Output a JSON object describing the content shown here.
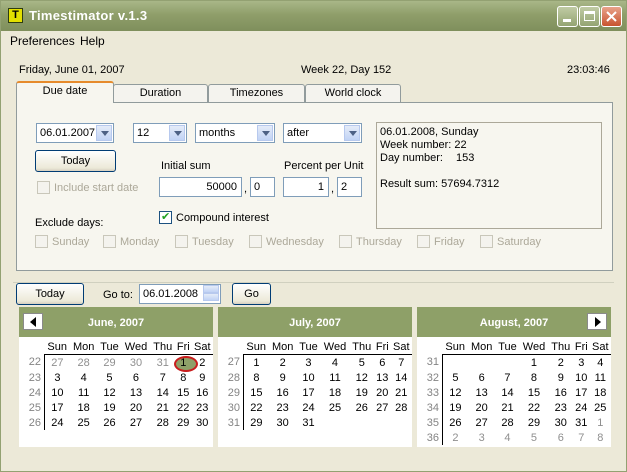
{
  "window": {
    "title": "Timestimator v.1.3",
    "icon_letter": "T"
  },
  "menu": {
    "items": [
      {
        "label": "Preferences",
        "accel": "P"
      },
      {
        "label": "Help",
        "accel": "H"
      }
    ]
  },
  "status": {
    "date": "Friday, June 01, 2007",
    "week": "Week 22, Day 152",
    "time": "23:03:46"
  },
  "tabs": [
    {
      "label": "Due date"
    },
    {
      "label": "Duration"
    },
    {
      "label": "Timezones"
    },
    {
      "label": "World clock"
    }
  ],
  "due": {
    "start_date": "06.01.2007",
    "amount": "12",
    "unit": "months",
    "direction": "after",
    "today_label": "Today",
    "include_start_label": "Include start date",
    "initial_sum_label": "Initial sum",
    "initial_sum_int": "50000",
    "initial_sum_frac": "0",
    "percent_label": "Percent per Unit",
    "percent_int": "1",
    "percent_frac": "2",
    "sep": ",",
    "compound_label": "Compound interest",
    "exclude_label": "Exclude days:",
    "weekdays": [
      "Sunday",
      "Monday",
      "Tuesday",
      "Wednesday",
      "Thursday",
      "Friday",
      "Saturday"
    ],
    "result": {
      "line1": "06.01.2008, Sunday",
      "line2": "Week number: 22",
      "line3_label": "Day number:",
      "line3_value": "153",
      "line4": "Result sum: 57694.7312"
    }
  },
  "goto": {
    "today_label": "Today",
    "goto_label": "Go to:",
    "date": "06.01.2008",
    "go_label": "Go"
  },
  "calendar": {
    "day_headers": [
      "Sun",
      "Mon",
      "Tue",
      "Wed",
      "Thu",
      "Fri",
      "Sat"
    ],
    "months": [
      {
        "title": "June, 2007",
        "weeks": [
          "22",
          "23",
          "24",
          "25",
          "26"
        ],
        "rows": [
          [
            [
              "27",
              true
            ],
            [
              "28",
              true
            ],
            [
              "29",
              true
            ],
            [
              "30",
              true
            ],
            [
              "31",
              true
            ],
            [
              "1",
              false
            ],
            [
              "2",
              false
            ]
          ],
          [
            [
              "3",
              false
            ],
            [
              "4",
              false
            ],
            [
              "5",
              false
            ],
            [
              "6",
              false
            ],
            [
              "7",
              false
            ],
            [
              "8",
              false
            ],
            [
              "9",
              false
            ]
          ],
          [
            [
              "10",
              false
            ],
            [
              "11",
              false
            ],
            [
              "12",
              false
            ],
            [
              "13",
              false
            ],
            [
              "14",
              false
            ],
            [
              "15",
              false
            ],
            [
              "16",
              false
            ]
          ],
          [
            [
              "17",
              false
            ],
            [
              "18",
              false
            ],
            [
              "19",
              false
            ],
            [
              "20",
              false
            ],
            [
              "21",
              false
            ],
            [
              "22",
              false
            ],
            [
              "23",
              false
            ]
          ],
          [
            [
              "24",
              false
            ],
            [
              "25",
              false
            ],
            [
              "26",
              false
            ],
            [
              "27",
              false
            ],
            [
              "28",
              false
            ],
            [
              "29",
              false
            ],
            [
              "30",
              false
            ]
          ]
        ],
        "today": "1"
      },
      {
        "title": "July, 2007",
        "weeks": [
          "27",
          "28",
          "29",
          "30",
          "31"
        ],
        "rows": [
          [
            [
              "1",
              false
            ],
            [
              "2",
              false
            ],
            [
              "3",
              false
            ],
            [
              "4",
              false
            ],
            [
              "5",
              false
            ],
            [
              "6",
              false
            ],
            [
              "7",
              false
            ]
          ],
          [
            [
              "8",
              false
            ],
            [
              "9",
              false
            ],
            [
              "10",
              false
            ],
            [
              "11",
              false
            ],
            [
              "12",
              false
            ],
            [
              "13",
              false
            ],
            [
              "14",
              false
            ]
          ],
          [
            [
              "15",
              false
            ],
            [
              "16",
              false
            ],
            [
              "17",
              false
            ],
            [
              "18",
              false
            ],
            [
              "19",
              false
            ],
            [
              "20",
              false
            ],
            [
              "21",
              false
            ]
          ],
          [
            [
              "22",
              false
            ],
            [
              "23",
              false
            ],
            [
              "24",
              false
            ],
            [
              "25",
              false
            ],
            [
              "26",
              false
            ],
            [
              "27",
              false
            ],
            [
              "28",
              false
            ]
          ],
          [
            [
              "29",
              false
            ],
            [
              "30",
              false
            ],
            [
              "31",
              false
            ],
            [
              "",
              false
            ],
            [
              "",
              false
            ],
            [
              "",
              false
            ],
            [
              "",
              false
            ]
          ]
        ],
        "today": ""
      },
      {
        "title": "August, 2007",
        "weeks": [
          "31",
          "32",
          "33",
          "34",
          "35",
          "36"
        ],
        "rows": [
          [
            [
              "",
              false
            ],
            [
              "",
              false
            ],
            [
              "",
              false
            ],
            [
              "1",
              false
            ],
            [
              "2",
              false
            ],
            [
              "3",
              false
            ],
            [
              "4",
              false
            ]
          ],
          [
            [
              "5",
              false
            ],
            [
              "6",
              false
            ],
            [
              "7",
              false
            ],
            [
              "8",
              false
            ],
            [
              "9",
              false
            ],
            [
              "10",
              false
            ],
            [
              "11",
              false
            ]
          ],
          [
            [
              "12",
              false
            ],
            [
              "13",
              false
            ],
            [
              "14",
              false
            ],
            [
              "15",
              false
            ],
            [
              "16",
              false
            ],
            [
              "17",
              false
            ],
            [
              "18",
              false
            ]
          ],
          [
            [
              "19",
              false
            ],
            [
              "20",
              false
            ],
            [
              "21",
              false
            ],
            [
              "22",
              false
            ],
            [
              "23",
              false
            ],
            [
              "24",
              false
            ],
            [
              "25",
              false
            ]
          ],
          [
            [
              "26",
              false
            ],
            [
              "27",
              false
            ],
            [
              "28",
              false
            ],
            [
              "29",
              false
            ],
            [
              "30",
              false
            ],
            [
              "31",
              false
            ],
            [
              "1",
              true
            ]
          ],
          [
            [
              "2",
              true
            ],
            [
              "3",
              true
            ],
            [
              "4",
              true
            ],
            [
              "5",
              true
            ],
            [
              "6",
              true
            ],
            [
              "7",
              true
            ],
            [
              "8",
              true
            ]
          ]
        ],
        "today": ""
      }
    ]
  },
  "colors": {
    "title_bar": "#8f9e6a",
    "calendar_header": "#8ea068",
    "today_circle": "#c81d1d",
    "active_tab_accent": "#e68b2c"
  }
}
